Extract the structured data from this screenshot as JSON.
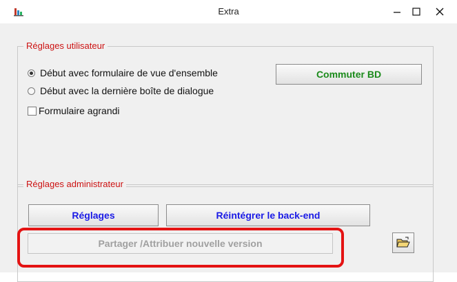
{
  "window": {
    "title": "Extra",
    "icons": {
      "app": "bar-chart-app-icon",
      "minimize": "minimize-icon",
      "maximize": "maximize-icon",
      "close": "close-icon"
    }
  },
  "user_settings": {
    "legend": "Réglages utilisateur",
    "radio_overview": "Début avec formulaire de vue d'ensemble",
    "radio_overview_selected": true,
    "radio_last_dialog": "Début avec la dernière boîte de dialogue",
    "checkbox_enlarged": "Formulaire agrandi",
    "checkbox_enlarged_checked": false,
    "switch_db_button": "Commuter BD"
  },
  "admin_settings": {
    "legend": "Réglages administrateur",
    "settings_button": "Réglages",
    "reintegrate_button": "Réintégrer le back-end",
    "share_button": "Partager /Attribuer nouvelle version",
    "share_button_enabled": false,
    "folder_icon": "open-folder-icon"
  },
  "colors": {
    "legend_text": "#cc1111",
    "blue_button_text": "#1a1ae6",
    "green_button_text": "#1a8a1a",
    "disabled_text": "#a0a0a0",
    "highlight": "#e41313"
  }
}
